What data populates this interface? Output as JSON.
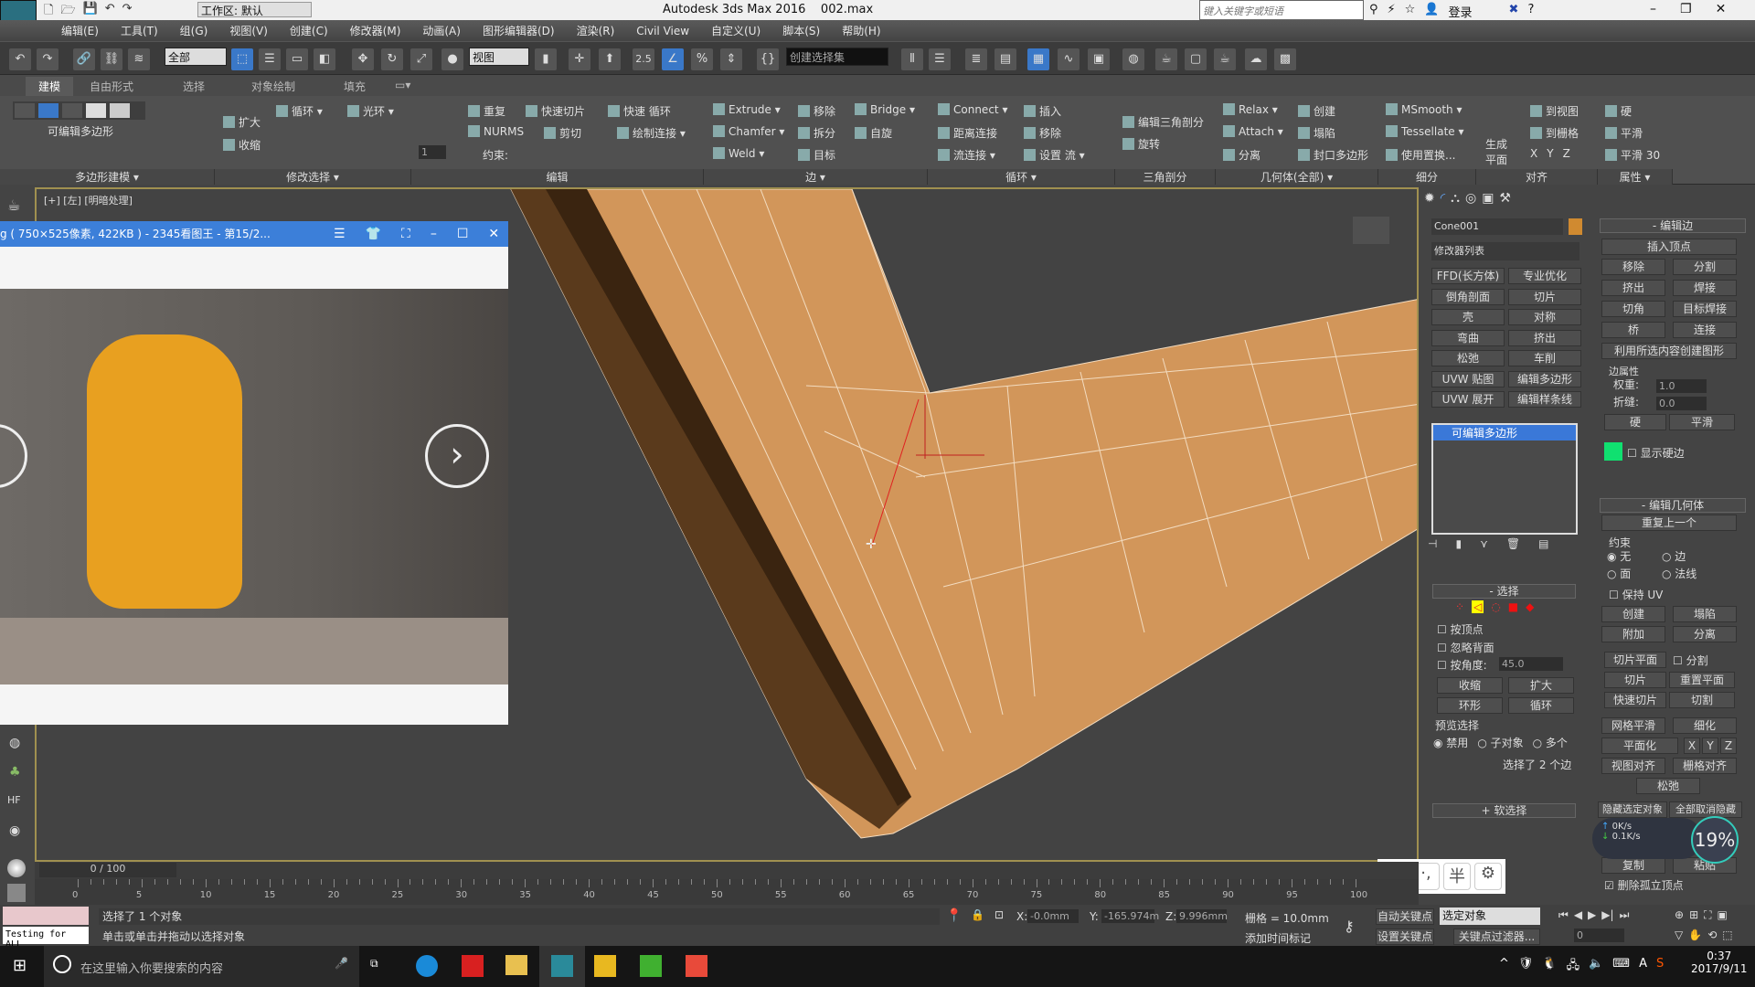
{
  "titlebar": {
    "title": "Autodesk 3ds Max 2016",
    "file": "002.max",
    "workspace": "工作区: 默认",
    "search_placeholder": "键入关键字或短语",
    "login": "登录",
    "logo": "MAX"
  },
  "menu": [
    "编辑(E)",
    "工具(T)",
    "组(G)",
    "视图(V)",
    "创建(C)",
    "修改器(M)",
    "动画(A)",
    "图形编辑器(D)",
    "渲染(R)",
    "Civil View",
    "自定义(U)",
    "脚本(S)",
    "帮助(H)"
  ],
  "toolbar": {
    "filter": "全部",
    "coord": "视图",
    "snap_value": "2.5",
    "selection_set": "创建选择集"
  },
  "ribbon_tabs": [
    "建模",
    "自由形式",
    "选择",
    "对象绘制",
    "填充"
  ],
  "ribbon": {
    "poly_label": "可编辑多边形",
    "mod_select": [
      "扩大",
      "收缩",
      "循环",
      "光环"
    ],
    "edit": [
      "重复",
      "快速切片",
      "快速 循环",
      "NURMS",
      "剪切",
      "绘制连接",
      "约束:"
    ],
    "edge": [
      "Extrude",
      "移除",
      "Bridge",
      "Chamfer",
      "拆分",
      "自旋",
      "Weld",
      "目标"
    ],
    "loops": [
      "Connect",
      "插入",
      "距离连接",
      "移除",
      "流连接",
      "设置 流"
    ],
    "tri": [
      "编辑三角剖分",
      "旋转"
    ],
    "geom": [
      "Relax",
      "创建",
      "Attach",
      "塌陷",
      "分离",
      "封口多边形"
    ],
    "subdiv": [
      "MSmooth",
      "Tessellate",
      "使用置换..."
    ],
    "align": [
      "生成平面",
      "到视图",
      "到栅格",
      "X",
      "Y",
      "Z"
    ],
    "props": [
      "硬",
      "平滑",
      "平滑 30"
    ],
    "spinner": "1",
    "groups": [
      "多边形建模 ▾",
      "修改选择 ▾",
      "编辑",
      "边 ▾",
      "循环 ▾",
      "三角剖分",
      "几何体(全部) ▾",
      "细分",
      "对齐",
      "属性 ▾"
    ]
  },
  "viewport": {
    "label": "[+] [左] [明暗处理]",
    "mesh_color": "#d2965a"
  },
  "image_viewer": {
    "title": "g ( 750×525像素, 422KB ) - 2345看图王 - 第15/2...",
    "bar_color": "#3c7fd9"
  },
  "command_panel": {
    "object_name": "Cone001",
    "object_color": "#d08a30",
    "modifier_list": "修改器列表",
    "modifier_buttons": [
      "FFD(长方体)",
      "专业优化",
      "倒角剖面",
      "切片",
      "壳",
      "对称",
      "弯曲",
      "挤出",
      "松弛",
      "车削",
      "UVW 贴图",
      "编辑多边形",
      "UVW 展开",
      "编辑样条线"
    ],
    "stack_item": "可编辑多边形",
    "selection": {
      "title": "选择",
      "by_vertex": "按顶点",
      "ignore_back": "忽略背面",
      "by_angle": "按角度:",
      "angle": "45.0",
      "shrink": "收缩",
      "grow": "扩大",
      "ring": "环形",
      "loop": "循环",
      "preview": "预览选择",
      "preview_opts": [
        "禁用",
        "子对象",
        "多个"
      ],
      "status": "选择了 2 个边"
    },
    "soft_selection": "软选择",
    "edit_edges": {
      "title": "编辑边",
      "insert_vertex": "插入顶点",
      "buttons": [
        "移除",
        "分割",
        "挤出",
        "焊接",
        "切角",
        "目标焊接",
        "桥",
        "连接"
      ],
      "create_shape": "利用所选内容创建图形",
      "edge_props": "边属性",
      "weight_label": "权重:",
      "weight": "1.0",
      "crease_label": "折缝:",
      "crease": "0.0",
      "hard": "硬",
      "smooth": "平滑",
      "show_hard": "显示硬边",
      "hard_color": "#10e070"
    },
    "edit_geometry": {
      "title": "编辑几何体",
      "repeat": "重复上一个",
      "constraint": "约束",
      "constraints": [
        "无",
        "边",
        "面",
        "法线"
      ],
      "keep_uv": "保持 UV",
      "buttons": [
        "创建",
        "塌陷",
        "附加",
        "分离"
      ],
      "slice_plane": "切片平面",
      "split": "分割",
      "slice": "切片",
      "reset_plane": "重置平面",
      "quickslice": "快速切片",
      "cut": "切割",
      "meshsmooth": "网格平滑",
      "tessellate": "细化",
      "planarize": "平面化",
      "xyz": [
        "X",
        "Y",
        "Z"
      ],
      "view_align": "视图对齐",
      "grid_align": "栅格对齐",
      "relax": "松弛",
      "hide_sel": "隐藏选定对象",
      "unhide_all": "全部取消隐藏",
      "copy": "复制",
      "paste": "粘贴",
      "delete_iso": "删除孤立顶点"
    }
  },
  "net_widget": {
    "up": "0K/s",
    "down": "0.1K/s",
    "percent": "19%"
  },
  "ime": [
    "A",
    "·,",
    "半",
    "⚙"
  ],
  "timeline": {
    "frame": "0 / 100",
    "ticks": [
      0,
      5,
      10,
      15,
      20,
      25,
      30,
      35,
      40,
      45,
      50,
      55,
      60,
      65,
      70,
      75,
      80,
      85,
      90,
      95,
      100
    ]
  },
  "status": {
    "maxscript": "Testing for ALL",
    "line1": "选择了 1 个对象",
    "line2": "单击或单击并拖动以选择对象",
    "x": "-0.0mm",
    "y": "-165.974m",
    "z": "9.996mm",
    "grid": "栅格 = 10.0mm",
    "add_time_tag": "添加时间标记",
    "auto_key": "自动关键点",
    "set_key": "设置关键点",
    "key_mode": "选定对象",
    "key_filters": "关键点过滤器...",
    "frame_field": "0"
  },
  "taskbar": {
    "search": "在这里输入你要搜索的内容",
    "time": "0:37",
    "date": "2017/9/11"
  }
}
